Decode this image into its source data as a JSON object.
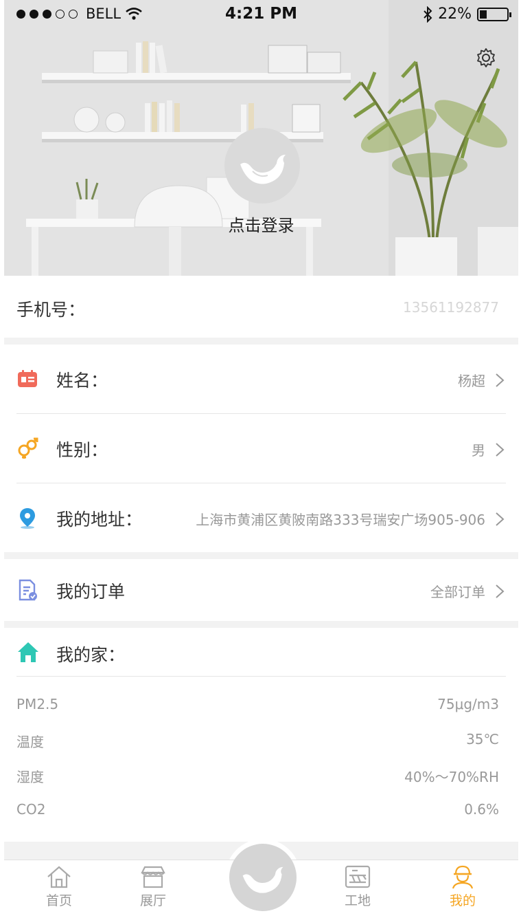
{
  "status_bar": {
    "carrier": "BELL",
    "time": "4:21 PM",
    "battery": "22%"
  },
  "header": {
    "login": "点击登录"
  },
  "phone": {
    "label": "手机号：",
    "value": "13561192877"
  },
  "profile_rows": [
    {
      "label": "姓名：",
      "value": "杨超"
    },
    {
      "label": "性别：",
      "value": "男"
    },
    {
      "label": "我的地址：",
      "value": "上海市黄浦区黄陂南路333号瑞安广场905-906"
    }
  ],
  "orders": {
    "label": "我的订单",
    "value": "全部订单"
  },
  "home": {
    "title": "我的家：",
    "stats": [
      {
        "key": "PM2.5",
        "value": "75μg/m3"
      },
      {
        "key": "温度",
        "value": "35℃"
      },
      {
        "key": "湿度",
        "value": "40%～70%RH"
      },
      {
        "key": "CO2",
        "value": "0.6%"
      }
    ]
  },
  "tabs": [
    {
      "label": "首页",
      "icon": "home-icon"
    },
    {
      "label": "展厅",
      "icon": "showroom-icon"
    },
    {
      "label": "",
      "icon": "bird-logo-icon"
    },
    {
      "label": "工地",
      "icon": "construction-icon"
    },
    {
      "label": "我的",
      "icon": "worker-icon"
    }
  ],
  "colors": {
    "accent": "#f5a623",
    "value_gray": "#999999",
    "avatar": "#dadada",
    "divider": "#e6e6e6",
    "home_teal": "#2ec7b4"
  }
}
